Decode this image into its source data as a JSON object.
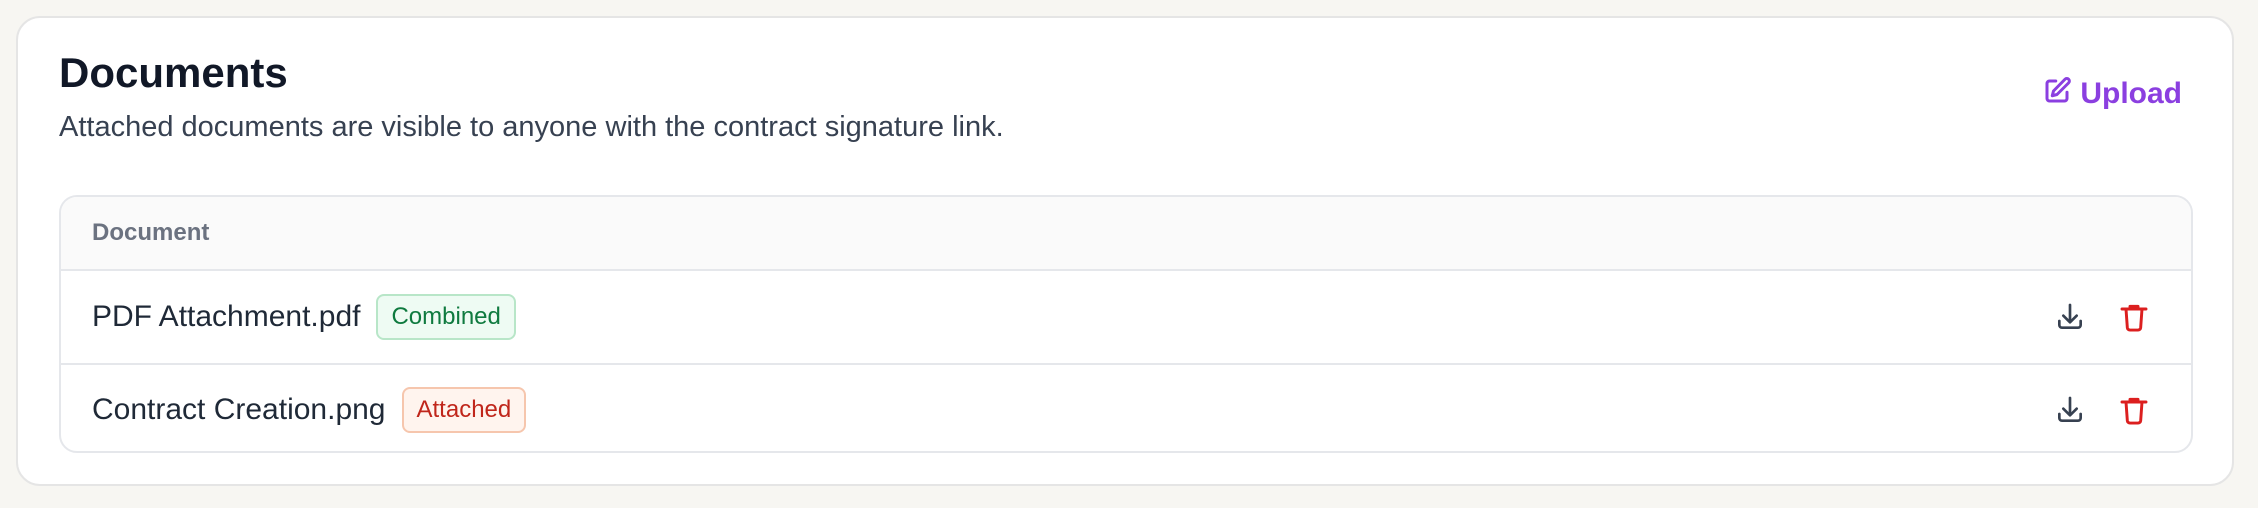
{
  "documents": {
    "title": "Documents",
    "subtitle": "Attached documents are visible to anyone with the contract signature link.",
    "upload_label": "Upload",
    "upload_icon": "edit-icon",
    "accent_color": "#8b3fe0",
    "table": {
      "columns": [
        "Document"
      ],
      "rows": [
        {
          "name": "PDF Attachment.pdf",
          "badge": "Combined",
          "badge_color": "#0f7a3f",
          "actions": [
            "download-icon",
            "trash-icon"
          ]
        },
        {
          "name": "Contract Creation.png",
          "badge": "Attached",
          "badge_color": "#c0261b",
          "actions": [
            "download-icon",
            "trash-icon"
          ]
        }
      ]
    }
  }
}
